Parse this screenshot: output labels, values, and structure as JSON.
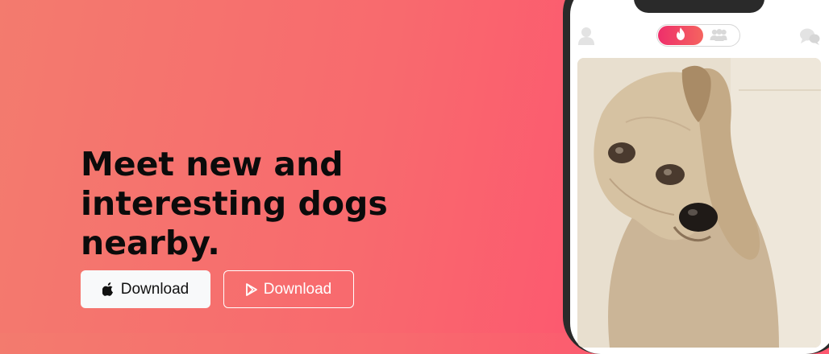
{
  "hero": {
    "headline_lines": [
      "Meet new and",
      "interesting dogs",
      "nearby."
    ]
  },
  "buttons": {
    "apple": {
      "label": "Download",
      "icon": "apple-icon"
    },
    "play": {
      "label": "Download",
      "icon": "play-store-icon"
    }
  },
  "app_preview": {
    "toggle_options": [
      {
        "icon": "flame-icon",
        "active": true
      },
      {
        "icon": "group-icon",
        "active": false
      }
    ],
    "left_icon": "profile-icon",
    "right_icon": "chat-icon",
    "card_subject": "dog photo"
  },
  "colors": {
    "background_start": "#f37b6e",
    "background_end": "#fd5870",
    "toggle_active_start": "#ee2f6b",
    "toggle_active_end": "#f5645f",
    "phone_frame": "#2a2a2a"
  }
}
